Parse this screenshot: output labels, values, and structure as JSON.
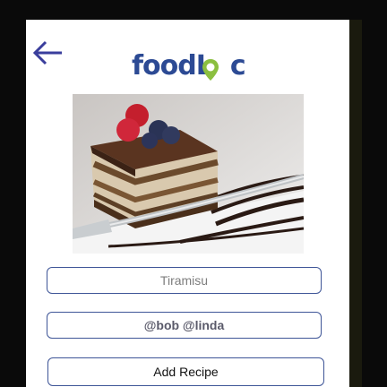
{
  "header": {
    "back_icon": "arrow-left-icon",
    "logo": {
      "text_prefix": "foodL",
      "text_suffix": "c",
      "pin_icon": "map-pin-icon",
      "color": "#2c4a94",
      "pin_color": "#8bbf3f"
    }
  },
  "photo": {
    "subject": "tiramisu-cake-image"
  },
  "form": {
    "dish_name": {
      "value": "Tiramisu"
    },
    "tags": {
      "value": "@bob @linda"
    },
    "add_recipe_label": "Add Recipe"
  },
  "colors": {
    "accent": "#3e5597",
    "background": "#ffffff"
  }
}
